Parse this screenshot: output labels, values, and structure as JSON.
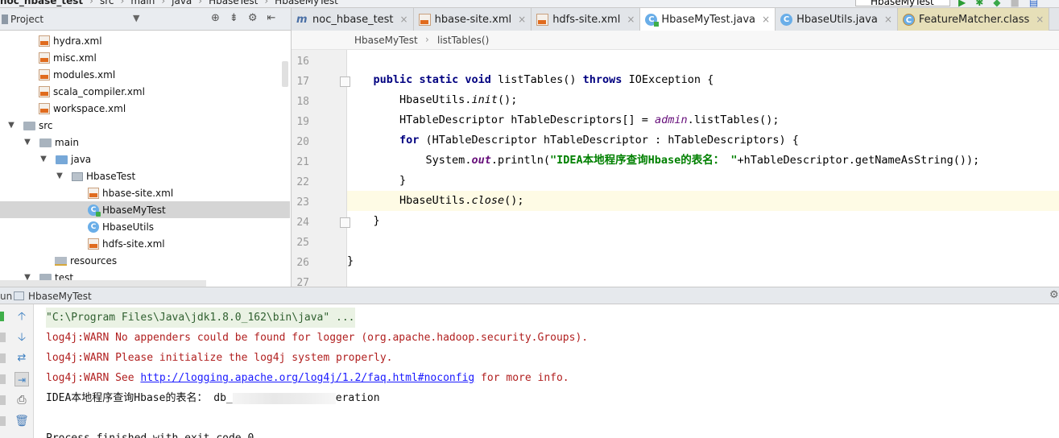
{
  "topbar": {
    "crumbs": [
      "noc_hbase_test",
      "src",
      "main",
      "java",
      "HbaseTest",
      "HbaseMyTest"
    ],
    "run_config": "HbaseMyTest"
  },
  "project": {
    "title": "Project",
    "tree": [
      {
        "label": "hydra.xml",
        "icon": "xml-file-icon"
      },
      {
        "label": "misc.xml",
        "icon": "xml-file-icon"
      },
      {
        "label": "modules.xml",
        "icon": "xml-file-icon"
      },
      {
        "label": "scala_compiler.xml",
        "icon": "xml-file-icon"
      },
      {
        "label": "workspace.xml",
        "icon": "xml-file-icon"
      },
      {
        "label": "src",
        "icon": "folder-icon"
      },
      {
        "label": "main",
        "icon": "folder-icon"
      },
      {
        "label": "java",
        "icon": "source-folder-icon"
      },
      {
        "label": "HbaseTest",
        "icon": "package-icon"
      },
      {
        "label": "hbase-site.xml",
        "icon": "xml-file-icon"
      },
      {
        "label": "HbaseMyTest",
        "icon": "java-class-icon"
      },
      {
        "label": "HbaseUtils",
        "icon": "java-class-icon"
      },
      {
        "label": "hdfs-site.xml",
        "icon": "xml-file-icon"
      },
      {
        "label": "resources",
        "icon": "resources-folder-icon"
      },
      {
        "label": "test",
        "icon": "folder-icon"
      }
    ]
  },
  "editor": {
    "tabs": [
      {
        "label": "noc_hbase_test",
        "icon": "module-icon"
      },
      {
        "label": "hbase-site.xml",
        "icon": "xml-file-icon"
      },
      {
        "label": "hdfs-site.xml",
        "icon": "xml-file-icon"
      },
      {
        "label": "HbaseMyTest.java",
        "icon": "java-class-icon",
        "active": true
      },
      {
        "label": "HbaseUtils.java",
        "icon": "java-class-icon"
      },
      {
        "label": "FeatureMatcher.class",
        "icon": "class-file-icon"
      }
    ],
    "breadcrumb": [
      "HbaseMyTest",
      "listTables()"
    ],
    "line_numbers": [
      "16",
      "17",
      "18",
      "19",
      "20",
      "21",
      "22",
      "23",
      "24",
      "25",
      "26",
      "27"
    ],
    "code": {
      "l17_kw1": "public",
      "l17_kw2": "static",
      "l17_kw3": "void",
      "l17_name": " listTables() ",
      "l17_kw4": "throws",
      "l17_rest": " IOException {",
      "l18_a": "HbaseUtils.",
      "l18_b": "init",
      "l18_c": "();",
      "l19_a": "HTableDescriptor hTableDescriptors[] = ",
      "l19_b": "admin",
      "l19_c": ".listTables();",
      "l20_kw": "for",
      "l20_rest": " (HTableDescriptor hTableDescriptor : hTableDescriptors) {",
      "l21_a": "System.",
      "l21_b": "out",
      "l21_c": ".println(",
      "l21_str": "\"IDEA本地程序查询Hbase的表名： \"",
      "l21_d": "+hTableDescriptor.getNameAsString());",
      "l22": "}",
      "l23_a": "HbaseUtils.",
      "l23_b": "close",
      "l23_c": "();",
      "l24": "}",
      "l26": "}"
    }
  },
  "run": {
    "label": "un",
    "config": "HbaseMyTest",
    "console": {
      "cmd": "\"C:\\Program Files\\Java\\jdk1.8.0_162\\bin\\java\" ...",
      "warn1": "log4j:WARN No appenders could be found for logger (org.apache.hadoop.security.Groups).",
      "warn2": "log4j:WARN Please initialize the log4j system properly.",
      "warn3_a": "log4j:WARN See ",
      "warn3_link": "http://logging.apache.org/log4j/1.2/faq.html#noconfig",
      "warn3_b": " for more info.",
      "out_a": "IDEA本地程序查询Hbase的表名： db_",
      "out_b": "eration",
      "finished": "Process finished with exit code 0"
    }
  }
}
